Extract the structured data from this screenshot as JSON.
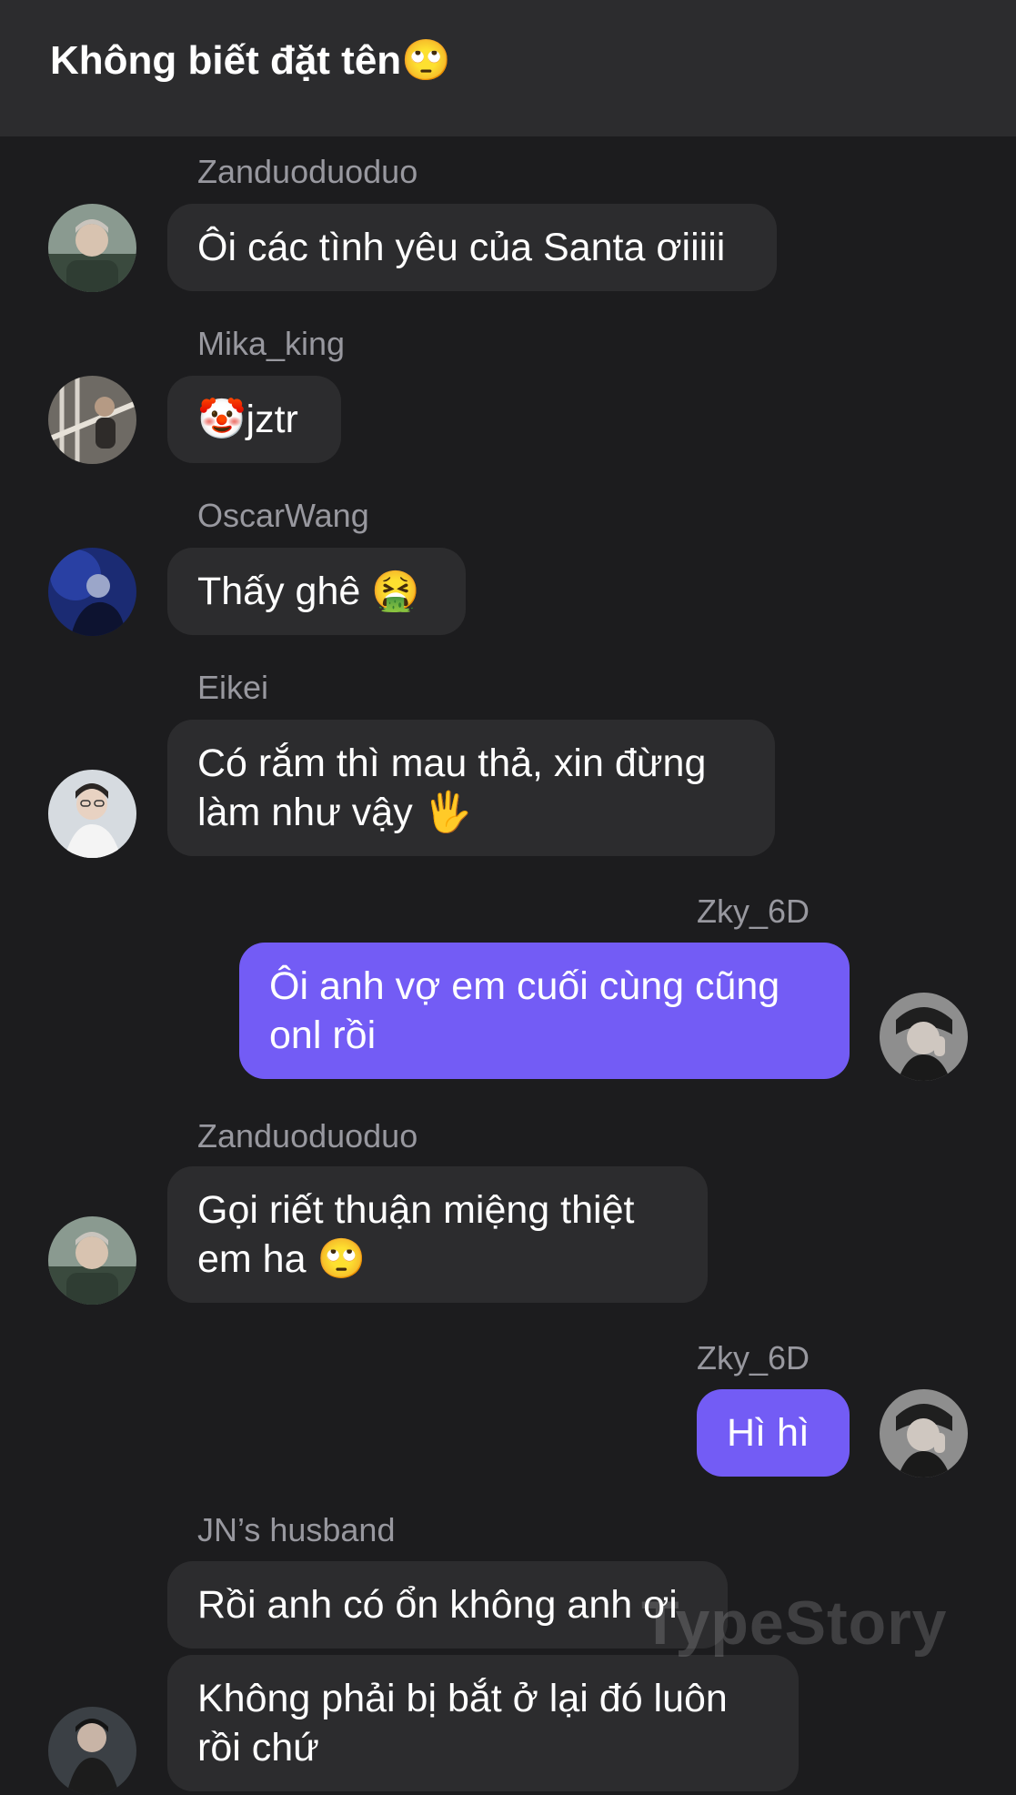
{
  "header": {
    "title": "Không biết đặt tên🙄"
  },
  "messages": [
    {
      "sender": "Zanduoduoduo",
      "text": "Ôi các tình yêu của Santa ơiiiii",
      "mine": false
    },
    {
      "sender": "Mika_king",
      "text": "🤡jztr",
      "mine": false
    },
    {
      "sender": "OscarWang",
      "text": "Thấy ghê 🤮",
      "mine": false
    },
    {
      "sender": "Eikei",
      "text": "Có rắm thì mau thả, xin đừng làm như vậy 🖐",
      "mine": false
    },
    {
      "sender": "Zky_6D",
      "text": "Ôi anh vợ em cuối cùng cũng onl rồi",
      "mine": true
    },
    {
      "sender": "Zanduoduoduo",
      "text": "Gọi riết thuận miệng thiệt em ha 🙄",
      "mine": false
    },
    {
      "sender": "Zky_6D",
      "text": "Hì hì",
      "mine": true
    },
    {
      "sender": "JN’s husband",
      "text": "Rồi anh có ổn không anh ơi",
      "mine": false
    },
    {
      "sender": "",
      "text": "Không phải bị bắt ở lại đó luôn rồi chứ",
      "mine": false
    }
  ],
  "watermark": "TypeStory",
  "colors": {
    "background": "#1c1c1e",
    "header": "#2c2c2e",
    "bubble_other": "#2c2c2e",
    "bubble_mine": "#735cf5",
    "sender_text": "#98989f"
  },
  "icons": [
    "avatar-zanduoduoduo",
    "avatar-mika-king",
    "avatar-oscarwang",
    "avatar-eikei",
    "avatar-zky-6d",
    "avatar-jn-husband"
  ]
}
